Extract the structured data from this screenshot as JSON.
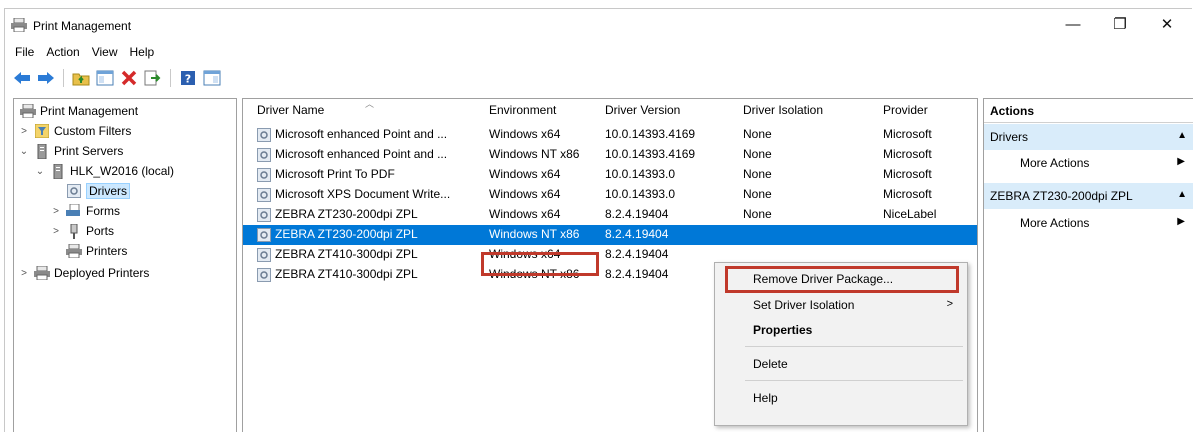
{
  "window": {
    "title": "Print Management",
    "controls": {
      "minimize": "—",
      "maximize": "❐",
      "close": "✕"
    }
  },
  "menu": [
    "File",
    "Action",
    "View",
    "Help"
  ],
  "tree": {
    "root": "Print Management",
    "custom_filters": "Custom Filters",
    "print_servers": "Print Servers",
    "server": "HLK_W2016 (local)",
    "drivers": "Drivers",
    "forms": "Forms",
    "ports": "Ports",
    "printers": "Printers",
    "deployed_printers": "Deployed Printers"
  },
  "list": {
    "columns": [
      "Driver Name",
      "Environment",
      "Driver Version",
      "Driver Isolation",
      "Provider"
    ],
    "rows": [
      [
        "Microsoft enhanced Point and ...",
        "Windows x64",
        "10.0.14393.4169",
        "None",
        "Microsoft"
      ],
      [
        "Microsoft enhanced Point and ...",
        "Windows NT x86",
        "10.0.14393.4169",
        "None",
        "Microsoft"
      ],
      [
        "Microsoft Print To PDF",
        "Windows x64",
        "10.0.14393.0",
        "None",
        "Microsoft"
      ],
      [
        "Microsoft XPS Document Write...",
        "Windows x64",
        "10.0.14393.0",
        "None",
        "Microsoft"
      ],
      [
        "ZEBRA ZT230-200dpi ZPL",
        "Windows x64",
        "8.2.4.19404",
        "None",
        "NiceLabel"
      ],
      [
        "ZEBRA ZT230-200dpi ZPL",
        "Windows NT x86",
        "8.2.4.19404",
        "",
        ""
      ],
      [
        "ZEBRA ZT410-300dpi ZPL",
        "Windows x64",
        "8.2.4.19404",
        "",
        ""
      ],
      [
        "ZEBRA ZT410-300dpi ZPL",
        "Windows NT x86",
        "8.2.4.19404",
        "",
        ""
      ]
    ],
    "selected_row": 5
  },
  "actions": {
    "title": "Actions",
    "section1": "Drivers",
    "section1_more": "More Actions",
    "section2": "ZEBRA ZT230-200dpi ZPL",
    "section2_more": "More Actions"
  },
  "context_menu": {
    "remove": "Remove Driver Package...",
    "isolation": "Set Driver Isolation",
    "properties": "Properties",
    "delete": "Delete",
    "help": "Help"
  },
  "colors": {
    "selection": "#0078d7",
    "highlight_box": "#c0392b",
    "action_section": "#d9ecfa"
  }
}
